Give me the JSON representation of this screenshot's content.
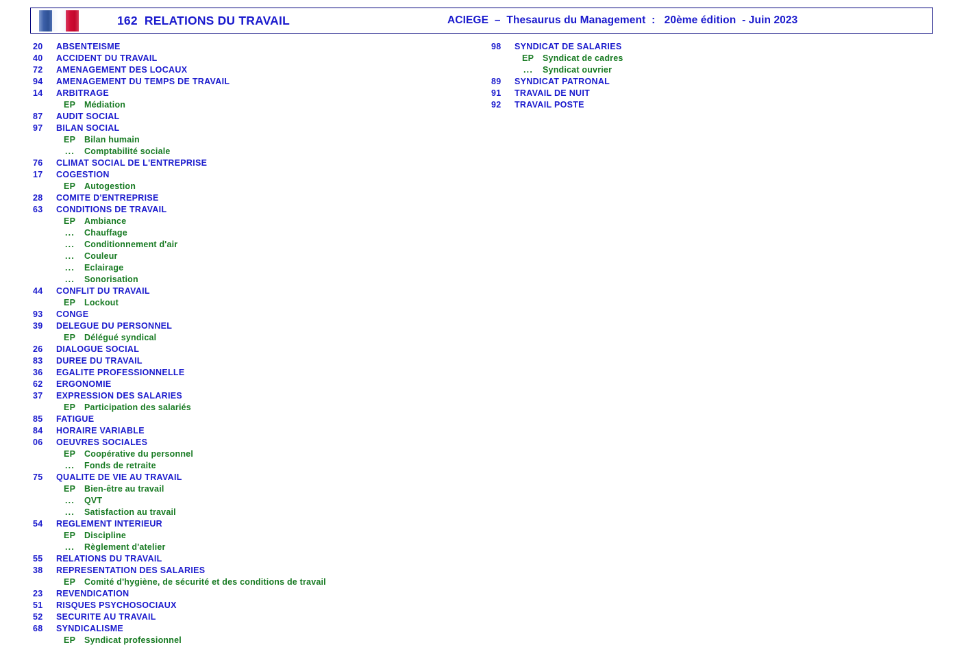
{
  "header": {
    "flag_icon": "french-flag-icon",
    "page_number": "162",
    "title": "162  RELATIONS DU TRAVAIL",
    "subtitle": "ACIEGE  –  Thesaurus du Management  :   20ème édition  - Juin 2023",
    "border_color": "#00007a"
  },
  "colors": {
    "term_blue": "#1a1acd",
    "synonym_green": "#177a22",
    "flag_blue": "#2f5195",
    "flag_red": "#c4062c"
  },
  "markers": {
    "ep": "EP",
    "dots": "..."
  },
  "left_column": [
    {
      "type": "term",
      "code": "20",
      "label": "ABSENTEISME"
    },
    {
      "type": "term",
      "code": "40",
      "label": "ACCIDENT DU TRAVAIL"
    },
    {
      "type": "term",
      "code": "72",
      "label": "AMENAGEMENT DES LOCAUX"
    },
    {
      "type": "term",
      "code": "94",
      "label": "AMENAGEMENT DU TEMPS DE TRAVAIL"
    },
    {
      "type": "term",
      "code": "14",
      "label": "ARBITRAGE"
    },
    {
      "type": "syn",
      "marker": "EP",
      "label": "Médiation"
    },
    {
      "type": "term",
      "code": "87",
      "label": "AUDIT SOCIAL"
    },
    {
      "type": "term",
      "code": "97",
      "label": "BILAN SOCIAL"
    },
    {
      "type": "syn",
      "marker": "EP",
      "label": "Bilan humain"
    },
    {
      "type": "syn",
      "marker": "...",
      "label": "Comptabilité sociale"
    },
    {
      "type": "term",
      "code": "76",
      "label": "CLIMAT SOCIAL DE L'ENTREPRISE"
    },
    {
      "type": "term",
      "code": "17",
      "label": "COGESTION"
    },
    {
      "type": "syn",
      "marker": "EP",
      "label": "Autogestion"
    },
    {
      "type": "term",
      "code": "28",
      "label": "COMITE D'ENTREPRISE"
    },
    {
      "type": "term",
      "code": "63",
      "label": "CONDITIONS DE TRAVAIL"
    },
    {
      "type": "syn",
      "marker": "EP",
      "label": "Ambiance"
    },
    {
      "type": "syn",
      "marker": "...",
      "label": "Chauffage"
    },
    {
      "type": "syn",
      "marker": "...",
      "label": "Conditionnement d'air"
    },
    {
      "type": "syn",
      "marker": "...",
      "label": "Couleur"
    },
    {
      "type": "syn",
      "marker": "...",
      "label": "Eclairage"
    },
    {
      "type": "syn",
      "marker": "...",
      "label": "Sonorisation"
    },
    {
      "type": "term",
      "code": "44",
      "label": "CONFLIT DU TRAVAIL"
    },
    {
      "type": "syn",
      "marker": "EP",
      "label": "Lockout"
    },
    {
      "type": "term",
      "code": "93",
      "label": "CONGE"
    },
    {
      "type": "term",
      "code": "39",
      "label": "DELEGUE DU PERSONNEL"
    },
    {
      "type": "syn",
      "marker": "EP",
      "label": "Délégué syndical"
    },
    {
      "type": "term",
      "code": "26",
      "label": "DIALOGUE SOCIAL"
    },
    {
      "type": "term",
      "code": "83",
      "label": "DUREE DU TRAVAIL"
    },
    {
      "type": "term",
      "code": "36",
      "label": "EGALITE PROFESSIONNELLE"
    },
    {
      "type": "term",
      "code": "62",
      "label": "ERGONOMIE"
    },
    {
      "type": "term",
      "code": "37",
      "label": "EXPRESSION DES SALARIES"
    },
    {
      "type": "syn",
      "marker": "EP",
      "label": "Participation des salariés"
    },
    {
      "type": "term",
      "code": "85",
      "label": "FATIGUE"
    },
    {
      "type": "term",
      "code": "84",
      "label": "HORAIRE VARIABLE"
    },
    {
      "type": "term",
      "code": "06",
      "label": "OEUVRES SOCIALES"
    },
    {
      "type": "syn",
      "marker": "EP",
      "label": "Coopérative du personnel"
    },
    {
      "type": "syn",
      "marker": "...",
      "label": "Fonds de retraite"
    },
    {
      "type": "term",
      "code": "75",
      "label": "QUALITE DE VIE AU TRAVAIL"
    },
    {
      "type": "syn",
      "marker": "EP",
      "label": "Bien-être au travail"
    },
    {
      "type": "syn",
      "marker": "...",
      "label": "QVT"
    },
    {
      "type": "syn",
      "marker": "...",
      "label": "Satisfaction au travail"
    },
    {
      "type": "term",
      "code": "54",
      "label": "REGLEMENT INTERIEUR"
    },
    {
      "type": "syn",
      "marker": "EP",
      "label": "Discipline"
    },
    {
      "type": "syn",
      "marker": "...",
      "label": "Règlement d'atelier"
    },
    {
      "type": "term",
      "code": "55",
      "label": "RELATIONS DU TRAVAIL"
    },
    {
      "type": "term",
      "code": "38",
      "label": "REPRESENTATION DES SALARIES"
    },
    {
      "type": "syn",
      "marker": "EP",
      "label": "Comité d'hygiène, de sécurité et des conditions de travail"
    },
    {
      "type": "term",
      "code": "23",
      "label": "REVENDICATION"
    },
    {
      "type": "term",
      "code": "51",
      "label": "RISQUES PSYCHOSOCIAUX"
    },
    {
      "type": "term",
      "code": "52",
      "label": "SECURITE AU TRAVAIL"
    },
    {
      "type": "term",
      "code": "68",
      "label": "SYNDICALISME"
    },
    {
      "type": "syn",
      "marker": "EP",
      "label": "Syndicat professionnel"
    }
  ],
  "right_column": [
    {
      "type": "term",
      "code": "98",
      "label": "SYNDICAT DE SALARIES"
    },
    {
      "type": "syn",
      "marker": "EP",
      "label": "Syndicat de cadres"
    },
    {
      "type": "syn",
      "marker": "...",
      "label": "Syndicat ouvrier"
    },
    {
      "type": "term",
      "code": "89",
      "label": "SYNDICAT PATRONAL"
    },
    {
      "type": "term",
      "code": "91",
      "label": "TRAVAIL DE NUIT"
    },
    {
      "type": "term",
      "code": "92",
      "label": "TRAVAIL POSTE"
    }
  ]
}
